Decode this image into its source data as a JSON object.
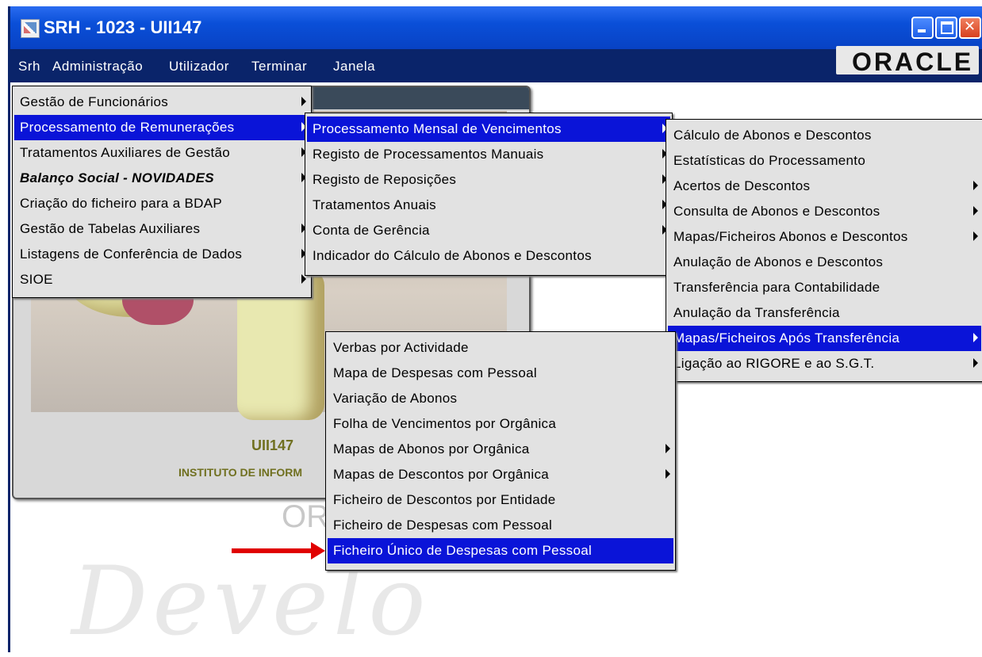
{
  "window": {
    "title": "SRH  - 1023 - UII147"
  },
  "menubar": {
    "items": [
      "Srh",
      "Administração",
      "Utilizador",
      "Terminar",
      "Janela"
    ],
    "logo": "ORACLE"
  },
  "form": {
    "code": "UII147",
    "institute": "INSTITUTO DE INFORM"
  },
  "menu1": {
    "items": [
      {
        "label": "Gestão de Funcionários",
        "submenu": true
      },
      {
        "label": "Processamento de Remunerações",
        "submenu": true,
        "selected": true
      },
      {
        "label": "Tratamentos Auxiliares de Gestão",
        "submenu": true
      },
      {
        "label": "Balanço Social - NOVIDADES",
        "submenu": true
      },
      {
        "label": "Criação do ficheiro para a BDAP",
        "submenu": false
      },
      {
        "label": "Gestão de Tabelas Auxiliares",
        "submenu": true
      },
      {
        "label": "Listagens de Conferência de Dados",
        "submenu": true
      },
      {
        "label": "SIOE",
        "submenu": true
      }
    ]
  },
  "menu2": {
    "items": [
      {
        "label": "Processamento Mensal de Vencimentos",
        "submenu": true,
        "selected": true
      },
      {
        "label": "Registo de Processamentos Manuais",
        "submenu": true
      },
      {
        "label": "Registo de Reposições",
        "submenu": true
      },
      {
        "label": "Tratamentos Anuais",
        "submenu": true
      },
      {
        "label": "Conta de Gerência",
        "submenu": true
      },
      {
        "label": "Indicador do Cálculo de Abonos e Descontos",
        "submenu": false
      }
    ]
  },
  "menu3": {
    "items": [
      {
        "label": "Cálculo de Abonos e Descontos",
        "submenu": false
      },
      {
        "label": "Estatísticas do Processamento",
        "submenu": false
      },
      {
        "label": "Acertos de Descontos",
        "submenu": true
      },
      {
        "label": "Consulta de Abonos e Descontos",
        "submenu": true
      },
      {
        "label": "Mapas/Ficheiros Abonos e Descontos",
        "submenu": true
      },
      {
        "label": "Anulação de Abonos e Descontos",
        "submenu": false
      },
      {
        "label": "Transferência para Contabilidade",
        "submenu": false
      },
      {
        "label": "Anulação da Transferência",
        "submenu": false
      },
      {
        "label": "Mapas/Ficheiros Após Transferência",
        "submenu": true,
        "selected": true
      },
      {
        "label": "Ligação ao RIGORE e ao S.G.T.",
        "submenu": true
      }
    ]
  },
  "menu4": {
    "items": [
      {
        "label": "Verbas por Actividade",
        "submenu": false
      },
      {
        "label": "Mapa de Despesas com Pessoal",
        "submenu": false
      },
      {
        "label": "Variação de Abonos",
        "submenu": false
      },
      {
        "label": "Folha de Vencimentos por Orgânica",
        "submenu": false
      },
      {
        "label": "Mapas de Abonos por Orgânica",
        "submenu": true
      },
      {
        "label": "Mapas de Descontos por Orgânica",
        "submenu": true
      },
      {
        "label": "Ficheiro de Descontos por Entidade",
        "submenu": false
      },
      {
        "label": "Ficheiro de Despesas com Pessoal",
        "submenu": false
      },
      {
        "label": "Ficheiro Único de Despesas com Pessoal",
        "submenu": false,
        "selected": true
      }
    ]
  },
  "colors": {
    "titlebar": "#0a4fd8",
    "menubar": "#0a246a",
    "highlight": "#0a14d8",
    "arrow": "#e00000"
  }
}
